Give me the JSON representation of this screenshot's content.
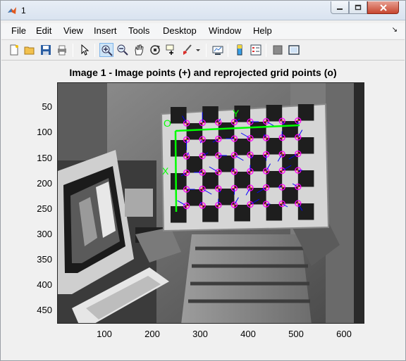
{
  "window": {
    "title": "1",
    "minimize": "minimize",
    "maximize": "maximize",
    "close": "close"
  },
  "menu": {
    "items": [
      "File",
      "Edit",
      "View",
      "Insert",
      "Tools",
      "Desktop",
      "Window",
      "Help"
    ]
  },
  "toolbar": {
    "icons": [
      "new-figure-icon",
      "open-file-icon",
      "save-icon",
      "print-icon",
      "pointer-icon",
      "zoom-in-icon",
      "zoom-out-icon",
      "pan-icon",
      "rotate-3d-icon",
      "data-cursor-icon",
      "brush-icon",
      "brush-dropdown-icon",
      "link-plot-icon",
      "colorbar-icon",
      "legend-icon",
      "hide-plot-tools-icon",
      "show-plot-tools-icon"
    ]
  },
  "plot": {
    "title": "Image 1 - Image points (+) and reprojected grid points (o)",
    "yticks": [
      "50",
      "100",
      "150",
      "200",
      "250",
      "300",
      "350",
      "400",
      "450"
    ],
    "xticks": [
      "100",
      "200",
      "300",
      "400",
      "500",
      "600"
    ],
    "origin_label": "O",
    "x_label": "X",
    "y_label": "Y",
    "accent_green": "#00ff00",
    "point_color": "#ff00ff",
    "arrow_color": "#0000ff"
  }
}
